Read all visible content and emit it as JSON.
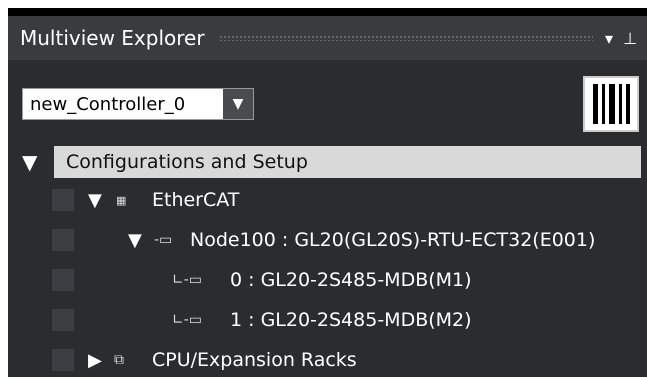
{
  "panel": {
    "title": "Multiview Explorer",
    "dropdown_icon": "chevron-down-icon",
    "pin_icon": "pin-icon"
  },
  "controller_select": {
    "value": "new_Controller_0",
    "arrow": "▼"
  },
  "tree": {
    "root": {
      "label": "Configurations and Setup",
      "toggle": "▼"
    },
    "ethercat": {
      "label": "EtherCAT",
      "toggle": "▼",
      "icon": "ethercat-icon"
    },
    "node100": {
      "label": "Node100 : GL20(GL20S)-RTU-ECT32(E001)",
      "toggle": "▼",
      "icon": "node-icon"
    },
    "m1": {
      "label": "0 : GL20-2S485-MDB(M1)",
      "icon": "module-icon"
    },
    "m2": {
      "label": "1 : GL20-2S485-MDB(M2)",
      "icon": "module-icon"
    },
    "cpu": {
      "label": "CPU/Expansion Racks",
      "toggle": "▶",
      "icon": "rack-icon"
    }
  },
  "colors": {
    "panel_bg": "#2b2c2e",
    "selection": "#d9d9d9",
    "text": "#ffffff"
  }
}
